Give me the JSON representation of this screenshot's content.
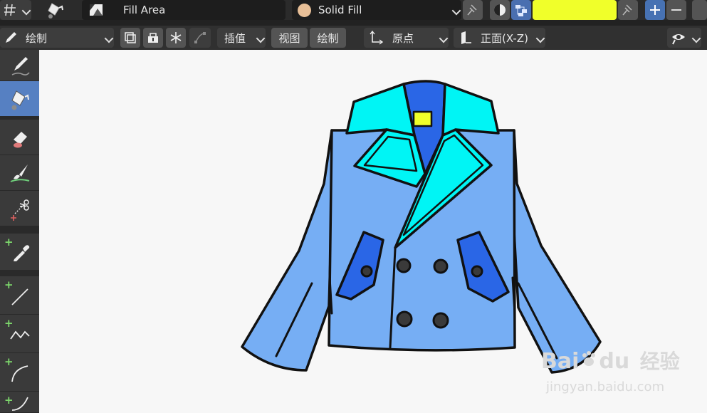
{
  "header": {
    "layer_name": "Fill Area",
    "material_name": "Solid Fill",
    "swatch_color": "#f0ff2a",
    "material_color": "#e8bf97"
  },
  "toolbar": {
    "mode_label": "绘制",
    "interpolate_label": "插值",
    "view_label": "视图",
    "draw_label": "绘制",
    "origin_label": "原点",
    "orientation_label": "正面(X-Z)"
  },
  "tools": [
    {
      "name": "draw-tool",
      "icon": "pencil-icon",
      "active": false
    },
    {
      "name": "fill-tool",
      "icon": "paint-bucket-icon",
      "active": true
    },
    {
      "name": "erase-tool",
      "icon": "eraser-icon",
      "active": false
    },
    {
      "name": "tint-tool",
      "icon": "brush-icon",
      "active": false
    },
    {
      "name": "cutter-tool",
      "icon": "scissors-icon",
      "active": false
    },
    {
      "name": "eyedropper-tool",
      "icon": "eyedropper-icon",
      "active": false
    },
    {
      "name": "line-tool",
      "icon": "line-icon",
      "active": false
    },
    {
      "name": "polyline-tool",
      "icon": "polyline-icon",
      "active": false
    },
    {
      "name": "arc-tool",
      "icon": "arc-icon",
      "active": false
    },
    {
      "name": "curve-tool",
      "icon": "curve-icon",
      "active": false
    }
  ],
  "colors": {
    "jacket_body": "#76aef4",
    "jacket_dark": "#2a66e6",
    "collar": "#00f5f5",
    "accent_yellow": "#f0ff2a",
    "active_tool": "#5680c2"
  },
  "watermark": {
    "brand_prefix": "Bai",
    "brand_suffix": "du",
    "brand_cn": "经验",
    "url": "jingyan.baidu.com"
  }
}
